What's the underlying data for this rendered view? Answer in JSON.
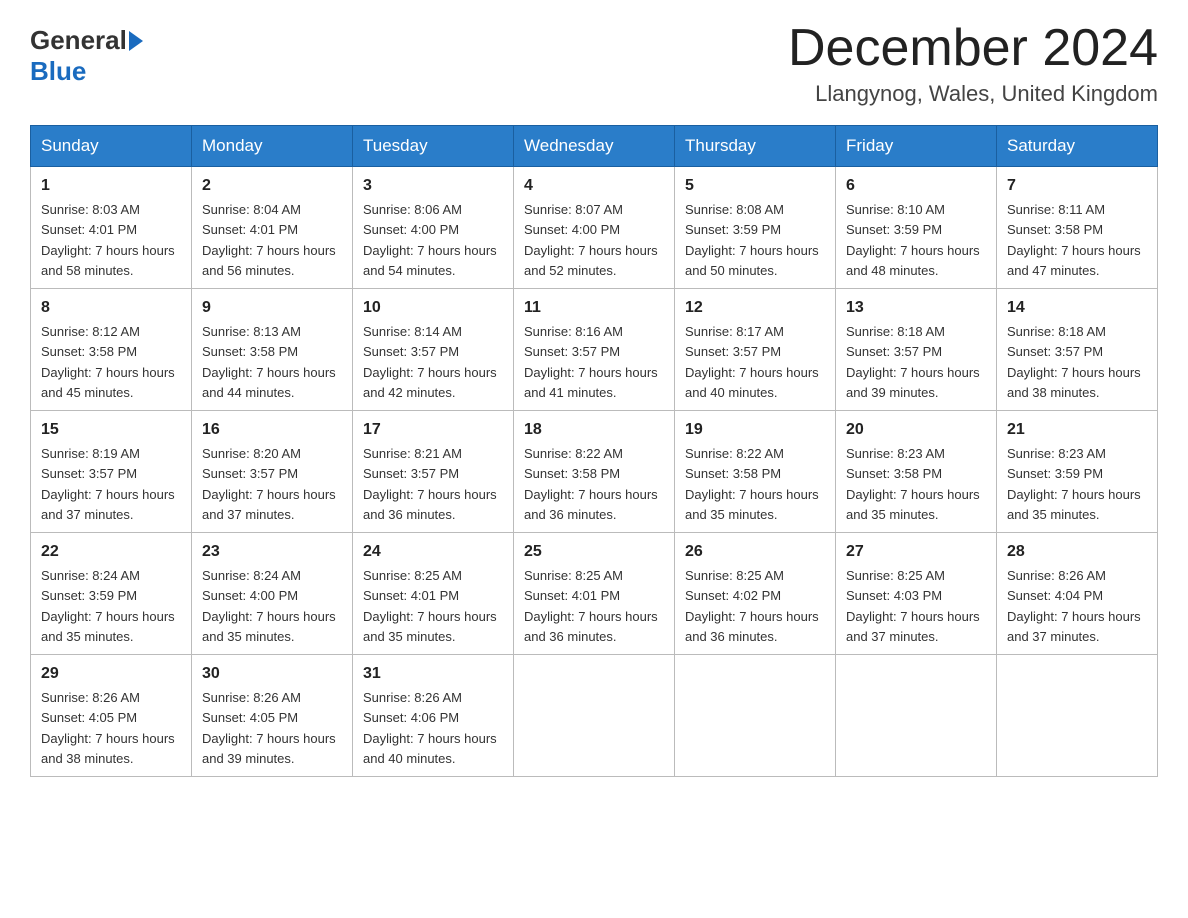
{
  "header": {
    "logo_general": "General",
    "logo_blue": "Blue",
    "title": "December 2024",
    "location": "Llangynog, Wales, United Kingdom"
  },
  "weekdays": [
    "Sunday",
    "Monday",
    "Tuesday",
    "Wednesday",
    "Thursday",
    "Friday",
    "Saturday"
  ],
  "weeks": [
    [
      {
        "day": "1",
        "sunrise": "8:03 AM",
        "sunset": "4:01 PM",
        "daylight": "7 hours and 58 minutes."
      },
      {
        "day": "2",
        "sunrise": "8:04 AM",
        "sunset": "4:01 PM",
        "daylight": "7 hours and 56 minutes."
      },
      {
        "day": "3",
        "sunrise": "8:06 AM",
        "sunset": "4:00 PM",
        "daylight": "7 hours and 54 minutes."
      },
      {
        "day": "4",
        "sunrise": "8:07 AM",
        "sunset": "4:00 PM",
        "daylight": "7 hours and 52 minutes."
      },
      {
        "day": "5",
        "sunrise": "8:08 AM",
        "sunset": "3:59 PM",
        "daylight": "7 hours and 50 minutes."
      },
      {
        "day": "6",
        "sunrise": "8:10 AM",
        "sunset": "3:59 PM",
        "daylight": "7 hours and 48 minutes."
      },
      {
        "day": "7",
        "sunrise": "8:11 AM",
        "sunset": "3:58 PM",
        "daylight": "7 hours and 47 minutes."
      }
    ],
    [
      {
        "day": "8",
        "sunrise": "8:12 AM",
        "sunset": "3:58 PM",
        "daylight": "7 hours and 45 minutes."
      },
      {
        "day": "9",
        "sunrise": "8:13 AM",
        "sunset": "3:58 PM",
        "daylight": "7 hours and 44 minutes."
      },
      {
        "day": "10",
        "sunrise": "8:14 AM",
        "sunset": "3:57 PM",
        "daylight": "7 hours and 42 minutes."
      },
      {
        "day": "11",
        "sunrise": "8:16 AM",
        "sunset": "3:57 PM",
        "daylight": "7 hours and 41 minutes."
      },
      {
        "day": "12",
        "sunrise": "8:17 AM",
        "sunset": "3:57 PM",
        "daylight": "7 hours and 40 minutes."
      },
      {
        "day": "13",
        "sunrise": "8:18 AM",
        "sunset": "3:57 PM",
        "daylight": "7 hours and 39 minutes."
      },
      {
        "day": "14",
        "sunrise": "8:18 AM",
        "sunset": "3:57 PM",
        "daylight": "7 hours and 38 minutes."
      }
    ],
    [
      {
        "day": "15",
        "sunrise": "8:19 AM",
        "sunset": "3:57 PM",
        "daylight": "7 hours and 37 minutes."
      },
      {
        "day": "16",
        "sunrise": "8:20 AM",
        "sunset": "3:57 PM",
        "daylight": "7 hours and 37 minutes."
      },
      {
        "day": "17",
        "sunrise": "8:21 AM",
        "sunset": "3:57 PM",
        "daylight": "7 hours and 36 minutes."
      },
      {
        "day": "18",
        "sunrise": "8:22 AM",
        "sunset": "3:58 PM",
        "daylight": "7 hours and 36 minutes."
      },
      {
        "day": "19",
        "sunrise": "8:22 AM",
        "sunset": "3:58 PM",
        "daylight": "7 hours and 35 minutes."
      },
      {
        "day": "20",
        "sunrise": "8:23 AM",
        "sunset": "3:58 PM",
        "daylight": "7 hours and 35 minutes."
      },
      {
        "day": "21",
        "sunrise": "8:23 AM",
        "sunset": "3:59 PM",
        "daylight": "7 hours and 35 minutes."
      }
    ],
    [
      {
        "day": "22",
        "sunrise": "8:24 AM",
        "sunset": "3:59 PM",
        "daylight": "7 hours and 35 minutes."
      },
      {
        "day": "23",
        "sunrise": "8:24 AM",
        "sunset": "4:00 PM",
        "daylight": "7 hours and 35 minutes."
      },
      {
        "day": "24",
        "sunrise": "8:25 AM",
        "sunset": "4:01 PM",
        "daylight": "7 hours and 35 minutes."
      },
      {
        "day": "25",
        "sunrise": "8:25 AM",
        "sunset": "4:01 PM",
        "daylight": "7 hours and 36 minutes."
      },
      {
        "day": "26",
        "sunrise": "8:25 AM",
        "sunset": "4:02 PM",
        "daylight": "7 hours and 36 minutes."
      },
      {
        "day": "27",
        "sunrise": "8:25 AM",
        "sunset": "4:03 PM",
        "daylight": "7 hours and 37 minutes."
      },
      {
        "day": "28",
        "sunrise": "8:26 AM",
        "sunset": "4:04 PM",
        "daylight": "7 hours and 37 minutes."
      }
    ],
    [
      {
        "day": "29",
        "sunrise": "8:26 AM",
        "sunset": "4:05 PM",
        "daylight": "7 hours and 38 minutes."
      },
      {
        "day": "30",
        "sunrise": "8:26 AM",
        "sunset": "4:05 PM",
        "daylight": "7 hours and 39 minutes."
      },
      {
        "day": "31",
        "sunrise": "8:26 AM",
        "sunset": "4:06 PM",
        "daylight": "7 hours and 40 minutes."
      },
      null,
      null,
      null,
      null
    ]
  ]
}
